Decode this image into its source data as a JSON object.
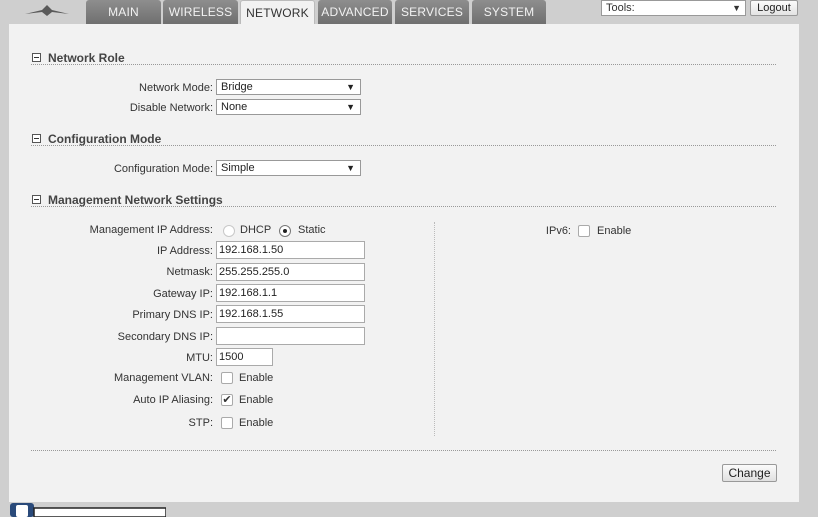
{
  "nav": {
    "tabs": [
      "MAIN",
      "WIRELESS",
      "NETWORK",
      "ADVANCED",
      "SERVICES",
      "SYSTEM"
    ],
    "active_tab": "NETWORK",
    "tools_select": "Tools:",
    "logout_label": "Logout"
  },
  "network_role": {
    "title": "Network Role",
    "network_mode_label": "Network Mode:",
    "network_mode_value": "Bridge",
    "disable_network_label": "Disable Network:",
    "disable_network_value": "None"
  },
  "configuration_mode": {
    "title": "Configuration Mode",
    "label": "Configuration Mode:",
    "value": "Simple"
  },
  "management": {
    "title": "Management Network Settings",
    "ip_address_mode_label": "Management IP Address:",
    "dhcp_label": "DHCP",
    "static_label": "Static",
    "selected_mode": "Static",
    "ip_address_label": "IP Address:",
    "ip_address_value": "192.168.1.50",
    "netmask_label": "Netmask:",
    "netmask_value": "255.255.255.0",
    "gateway_label": "Gateway IP:",
    "gateway_value": "192.168.1.1",
    "primary_dns_label": "Primary DNS IP:",
    "primary_dns_value": "192.168.1.55",
    "secondary_dns_label": "Secondary DNS IP:",
    "secondary_dns_value": "",
    "mtu_label": "MTU:",
    "mtu_value": "1500",
    "vlan_label": "Management VLAN:",
    "vlan_enable_label": "Enable",
    "vlan_enabled": false,
    "auto_ip_label": "Auto IP Aliasing:",
    "auto_ip_enable_label": "Enable",
    "auto_ip_enabled": true,
    "stp_label": "STP:",
    "stp_enable_label": "Enable",
    "stp_enabled": false,
    "ipv6_label": "IPv6:",
    "ipv6_enable_label": "Enable",
    "ipv6_enabled": false
  },
  "change_button_label": "Change",
  "icons": {
    "logo": "ubiquiti-logo-icon",
    "dropdown": "chevron-down-icon",
    "collapse": "collapse-icon"
  },
  "colors": {
    "active_tab_bg": "#f2f2f2",
    "tab_bg": "#7f7f7f",
    "page_bg": "#cfcfcf",
    "panel_bg": "#f2f2f2"
  }
}
